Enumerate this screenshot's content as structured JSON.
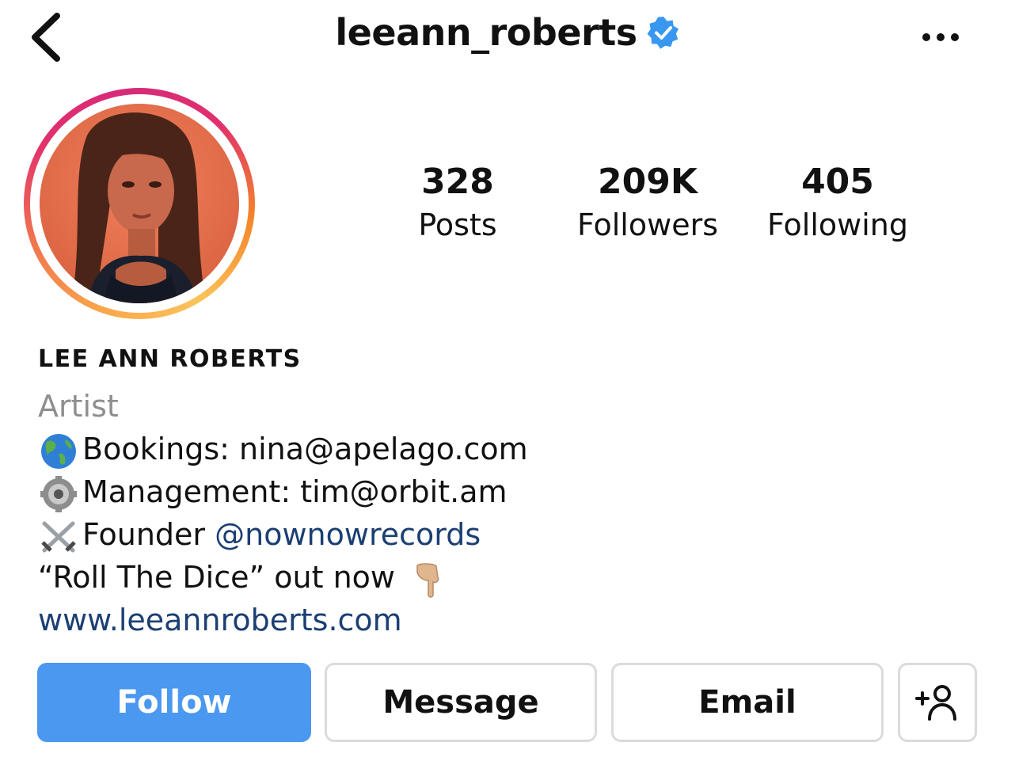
{
  "header": {
    "username": "leeann_roberts",
    "verified": true,
    "back_icon": "chevron-left-icon",
    "more_icon": "more-horizontal-icon"
  },
  "stats": [
    {
      "value": "328",
      "label": "Posts"
    },
    {
      "value": "209K",
      "label": "Followers"
    },
    {
      "value": "405",
      "label": "Following"
    }
  ],
  "bio": {
    "full_name": "LEE ANN ROBERTS",
    "category": "Artist",
    "bookings": "Bookings: nina@apelago.com",
    "management": "Management: tim@orbit.am",
    "founder_prefix": "Founder ",
    "founder_handle": "@nownowrecords",
    "release": "“Roll The Dice” out now",
    "website": "www.leeannroberts.com"
  },
  "actions": {
    "follow": "Follow",
    "message": "Message",
    "email": "Email",
    "add_user_icon": "add-person-icon"
  },
  "colors": {
    "follow_button": "#4a98f0",
    "link": "#1b3f73",
    "muted": "#8e8e8e",
    "verified": "#3897f0"
  }
}
